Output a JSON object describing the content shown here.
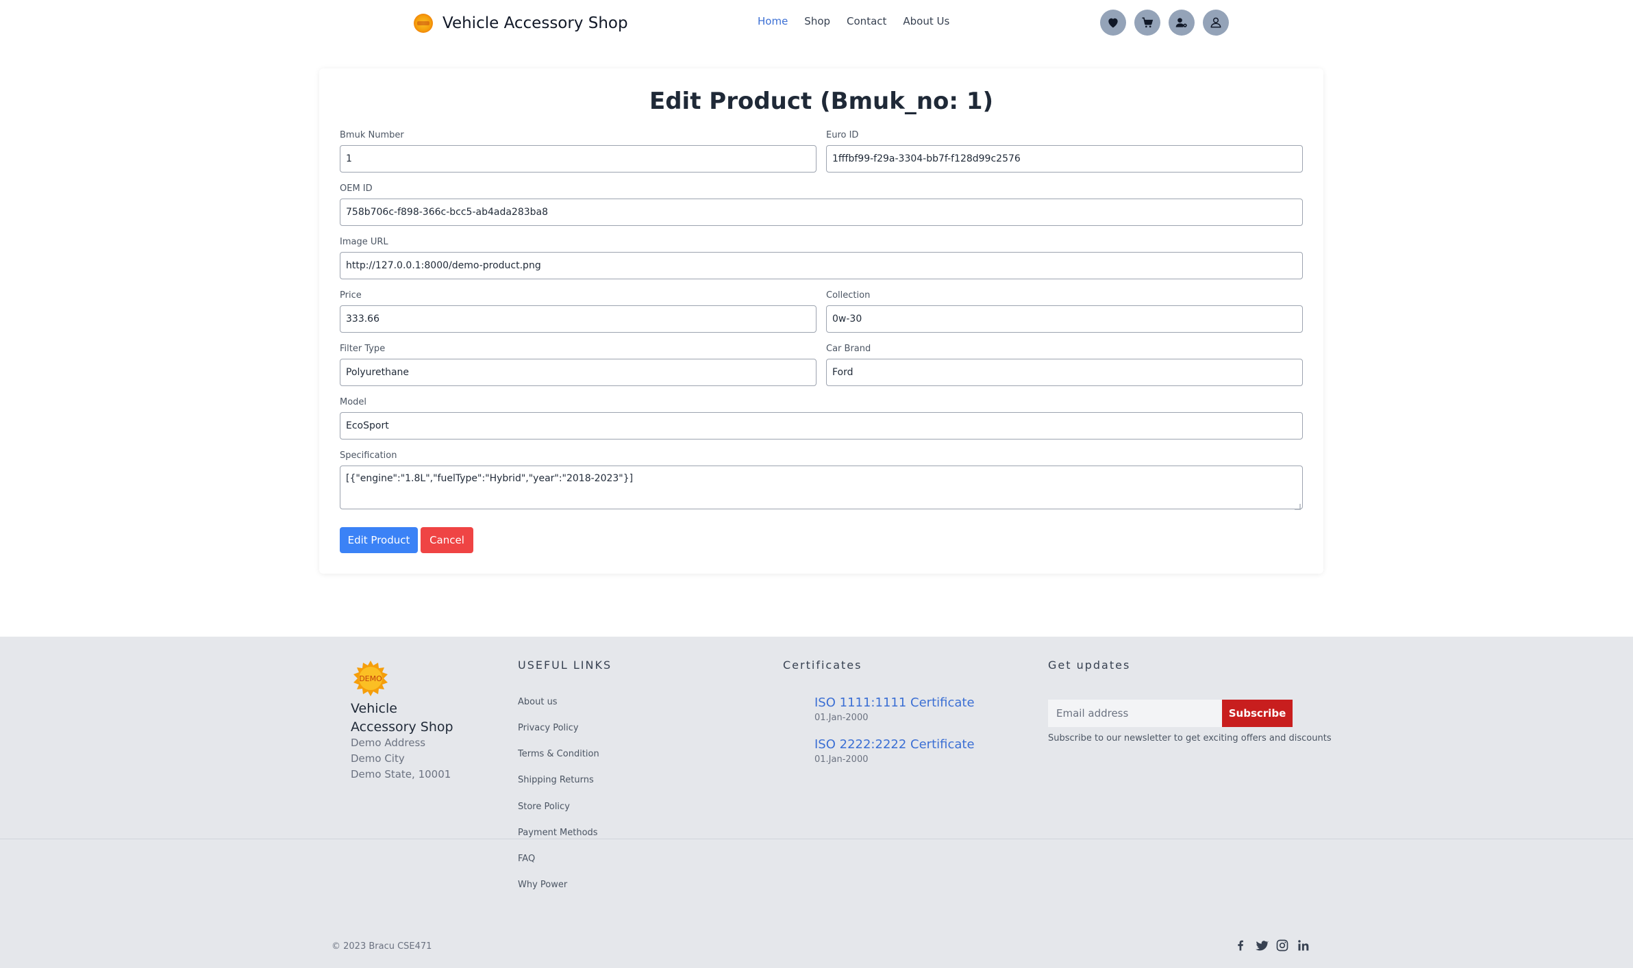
{
  "header": {
    "brand_name": "Vehicle Accessory Shop",
    "nav": [
      {
        "label": "Home",
        "active": true
      },
      {
        "label": "Shop",
        "active": false
      },
      {
        "label": "Contact",
        "active": false
      },
      {
        "label": "About Us",
        "active": false
      }
    ],
    "icons": [
      "heart-icon",
      "cart-icon",
      "user-settings-icon",
      "user-icon"
    ]
  },
  "form": {
    "title": "Edit Product (Bmuk_no: 1)",
    "fields": {
      "bmuk_number": {
        "label": "Bmuk Number",
        "value": "1"
      },
      "euro_id": {
        "label": "Euro ID",
        "value": "1fffbf99-f29a-3304-bb7f-f128d99c2576"
      },
      "oem_id": {
        "label": "OEM ID",
        "value": "758b706c-f898-366c-bcc5-ab4ada283ba8"
      },
      "image_url": {
        "label": "Image URL",
        "value": "http://127.0.0.1:8000/demo-product.png"
      },
      "price": {
        "label": "Price",
        "value": "333.66"
      },
      "collection": {
        "label": "Collection",
        "value": "0w-30"
      },
      "filter_type": {
        "label": "Filter Type",
        "value": "Polyurethane"
      },
      "car_brand": {
        "label": "Car Brand",
        "value": "Ford"
      },
      "model": {
        "label": "Model",
        "value": "EcoSport"
      },
      "specification": {
        "label": "Specification",
        "value": "[{\"engine\":\"1.8L\",\"fuelType\":\"Hybrid\",\"year\":\"2018-2023\"}]"
      }
    },
    "submit_label": "Edit Product",
    "cancel_label": "Cancel"
  },
  "footer": {
    "logo_text": "DEMO",
    "brand_name": "Vehicle Accessory Shop",
    "address": [
      "Demo Address",
      "Demo City",
      "Demo State, 10001"
    ],
    "useful_links_heading": "USEFUL LINKS",
    "useful_links": [
      "About us",
      "Privacy Policy",
      "Terms & Condition",
      "Shipping Returns",
      "Store Policy",
      "Payment Methods",
      "FAQ",
      "Why Power"
    ],
    "certificates_heading": "Certificates",
    "certificates": [
      {
        "name": "ISO 1111:1111 Certificate",
        "date": "01.Jan-2000"
      },
      {
        "name": "ISO 2222:2222 Certificate",
        "date": "01.Jan-2000"
      }
    ],
    "updates_heading": "Get updates",
    "email_placeholder": "Email address",
    "subscribe_label": "Subscribe",
    "newsletter_note": "Subscribe to our newsletter to get exciting offers and discounts",
    "copyright": "© 2023 Bracu CSE471",
    "social": [
      "facebook-icon",
      "twitter-icon",
      "instagram-icon",
      "linkedin-icon"
    ]
  },
  "colors": {
    "accent": "#3b82f6",
    "danger": "#ef4444",
    "subscribe": "#c81e1e",
    "nav_active": "#3b6fd4",
    "footer_bg": "#e5e7eb"
  }
}
